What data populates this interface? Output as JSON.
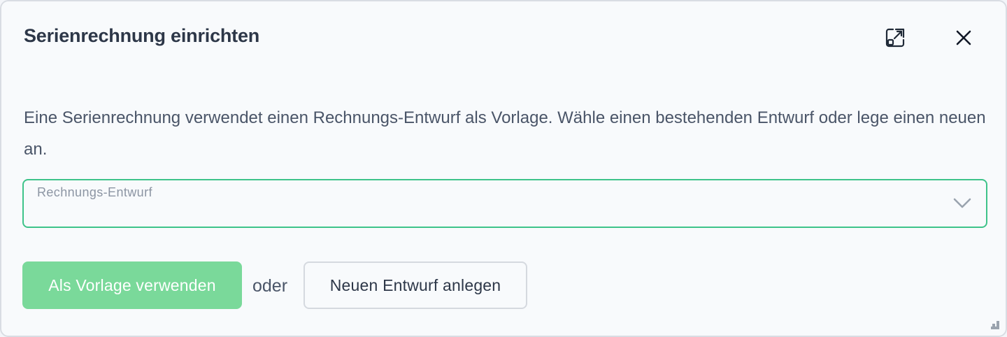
{
  "dialog": {
    "title": "Serienrechnung einrichten",
    "expand_icon": "expand-icon",
    "close_icon": "close-icon",
    "description": "Eine Serienrechnung verwendet einen Rechnungs-Entwurf als Vorlage. Wähle einen bestehenden Entwurf oder lege einen neuen an.",
    "select": {
      "label": "Rechnungs-Entwurf",
      "selected_value": "",
      "icon": "chevron-down-icon",
      "border_color": "#3ec38a"
    },
    "actions": {
      "primary_label": "Als Vorlage verwenden",
      "primary_color": "#7ad99a",
      "separator": "oder",
      "secondary_label": "Neuen Entwurf anlegen"
    },
    "resize_icon": "resize-handle-icon"
  }
}
